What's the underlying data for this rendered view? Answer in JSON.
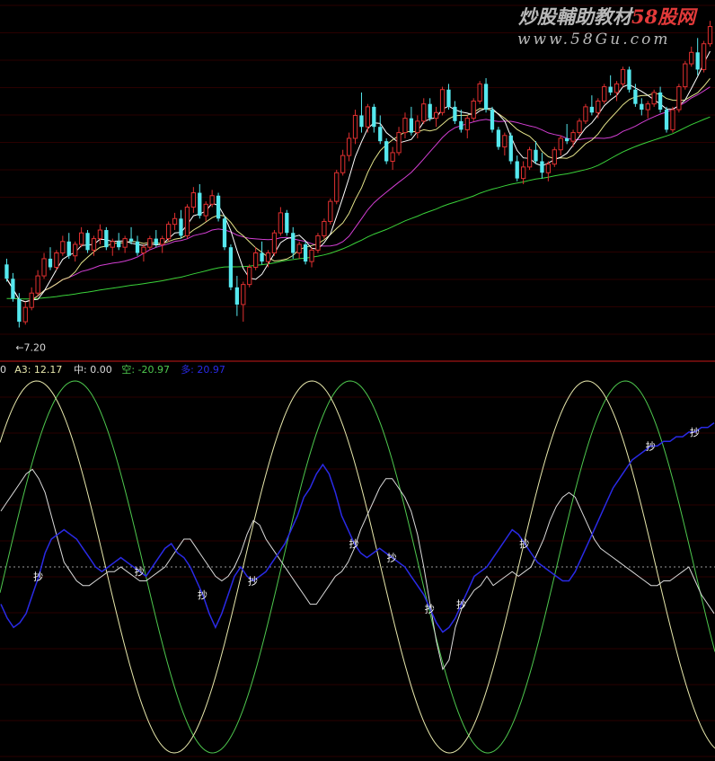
{
  "watermark": {
    "title_a": "炒股輔助教材",
    "title_b": "58股网",
    "url": "www.58Gu.com",
    "color_a": "#b9b9b9",
    "color_b": "#e23a3a"
  },
  "colors": {
    "background": "#000000",
    "grid": "#2a0000",
    "divider": "#c81818",
    "up": "#e03030",
    "down": "#55e8ee",
    "ma5": "#ffffff",
    "ma10": "#e6e68c",
    "ma20": "#d23ed2",
    "ma60": "#3ad23a",
    "sine_a": "#e8e8ac",
    "sine_b": "#4ec84e",
    "osc_white": "#dadada",
    "osc_blue": "#2a2ae6",
    "zero_line": "#9a9a9a",
    "signal_text": "#ffffff"
  },
  "chart_data": [
    {
      "type": "candlestick",
      "name": "price",
      "low_label": "←7.20",
      "low_value": 7.2,
      "ylim": [
        6.8,
        12.6
      ],
      "bars": 114,
      "overlays": [
        "MA5",
        "MA10",
        "MA20",
        "MA60"
      ],
      "ohlc": [
        [
          8.3,
          8.4,
          8.0,
          8.05
        ],
        [
          8.05,
          8.15,
          7.65,
          7.7
        ],
        [
          7.7,
          7.8,
          7.2,
          7.3
        ],
        [
          7.3,
          7.65,
          7.25,
          7.55
        ],
        [
          7.55,
          7.9,
          7.5,
          7.8
        ],
        [
          7.8,
          8.2,
          7.75,
          8.1
        ],
        [
          8.1,
          8.5,
          8.05,
          8.4
        ],
        [
          8.4,
          8.6,
          8.2,
          8.25
        ],
        [
          8.25,
          8.55,
          8.2,
          8.5
        ],
        [
          8.5,
          8.8,
          8.45,
          8.7
        ],
        [
          8.7,
          8.85,
          8.4,
          8.45
        ],
        [
          8.45,
          8.7,
          8.35,
          8.65
        ],
        [
          8.65,
          8.95,
          8.6,
          8.85
        ],
        [
          8.85,
          8.9,
          8.5,
          8.55
        ],
        [
          8.55,
          8.8,
          8.45,
          8.75
        ],
        [
          8.75,
          9.0,
          8.65,
          8.9
        ],
        [
          8.9,
          8.95,
          8.55,
          8.6
        ],
        [
          8.6,
          8.75,
          8.45,
          8.7
        ],
        [
          8.7,
          8.85,
          8.55,
          8.6
        ],
        [
          8.6,
          8.8,
          8.5,
          8.75
        ],
        [
          8.75,
          8.95,
          8.65,
          8.7
        ],
        [
          8.7,
          8.8,
          8.45,
          8.5
        ],
        [
          8.5,
          8.65,
          8.35,
          8.6
        ],
        [
          8.6,
          8.8,
          8.55,
          8.75
        ],
        [
          8.75,
          8.9,
          8.6,
          8.65
        ],
        [
          8.65,
          8.8,
          8.5,
          8.75
        ],
        [
          8.75,
          9.05,
          8.7,
          9.0
        ],
        [
          9.0,
          9.2,
          8.9,
          9.1
        ],
        [
          9.1,
          9.25,
          8.75,
          8.8
        ],
        [
          8.8,
          9.35,
          8.75,
          9.3
        ],
        [
          9.3,
          9.65,
          9.2,
          9.55
        ],
        [
          9.55,
          9.7,
          9.1,
          9.15
        ],
        [
          9.15,
          9.4,
          9.05,
          9.35
        ],
        [
          9.35,
          9.6,
          9.3,
          9.5
        ],
        [
          9.5,
          9.55,
          9.05,
          9.1
        ],
        [
          9.1,
          9.15,
          8.55,
          8.6
        ],
        [
          8.6,
          8.65,
          7.85,
          7.9
        ],
        [
          7.9,
          8.1,
          7.4,
          7.6
        ],
        [
          7.6,
          8.0,
          7.3,
          7.95
        ],
        [
          7.95,
          8.3,
          7.9,
          8.25
        ],
        [
          8.25,
          8.6,
          8.2,
          8.5
        ],
        [
          8.5,
          8.7,
          8.3,
          8.35
        ],
        [
          8.35,
          8.55,
          8.25,
          8.5
        ],
        [
          8.5,
          8.9,
          8.45,
          8.85
        ],
        [
          8.85,
          9.3,
          8.8,
          9.2
        ],
        [
          9.2,
          9.25,
          8.8,
          8.85
        ],
        [
          8.85,
          8.95,
          8.4,
          8.5
        ],
        [
          8.5,
          8.7,
          8.4,
          8.65
        ],
        [
          8.65,
          8.7,
          8.3,
          8.35
        ],
        [
          8.35,
          8.6,
          8.25,
          8.55
        ],
        [
          8.55,
          8.85,
          8.5,
          8.8
        ],
        [
          8.8,
          9.1,
          8.75,
          9.05
        ],
        [
          9.05,
          9.45,
          9.0,
          9.4
        ],
        [
          9.4,
          9.95,
          9.35,
          9.9
        ],
        [
          9.9,
          10.3,
          9.85,
          10.2
        ],
        [
          10.2,
          10.6,
          10.1,
          10.5
        ],
        [
          10.5,
          11.0,
          10.4,
          10.9
        ],
        [
          10.9,
          11.3,
          10.6,
          10.7
        ],
        [
          10.7,
          11.1,
          10.6,
          11.05
        ],
        [
          11.05,
          11.1,
          10.6,
          10.7
        ],
        [
          10.7,
          10.9,
          10.4,
          10.45
        ],
        [
          10.45,
          10.5,
          10.05,
          10.1
        ],
        [
          10.1,
          10.35,
          9.95,
          10.25
        ],
        [
          10.25,
          10.7,
          10.2,
          10.6
        ],
        [
          10.6,
          10.95,
          10.5,
          10.85
        ],
        [
          10.85,
          11.05,
          10.55,
          10.6
        ],
        [
          10.6,
          10.9,
          10.5,
          10.8
        ],
        [
          10.8,
          11.2,
          10.75,
          11.1
        ],
        [
          11.1,
          11.2,
          10.8,
          10.85
        ],
        [
          10.85,
          11.05,
          10.7,
          10.95
        ],
        [
          10.95,
          11.4,
          10.9,
          11.35
        ],
        [
          11.35,
          11.45,
          11.0,
          11.05
        ],
        [
          11.05,
          11.15,
          10.75,
          10.8
        ],
        [
          10.8,
          11.0,
          10.6,
          10.65
        ],
        [
          10.65,
          10.9,
          10.5,
          10.85
        ],
        [
          10.85,
          11.2,
          10.8,
          11.15
        ],
        [
          11.15,
          11.5,
          11.1,
          11.45
        ],
        [
          11.45,
          11.55,
          10.95,
          11.0
        ],
        [
          11.0,
          11.05,
          10.6,
          10.65
        ],
        [
          10.65,
          10.7,
          10.3,
          10.35
        ],
        [
          10.35,
          10.6,
          10.2,
          10.55
        ],
        [
          10.55,
          10.6,
          10.05,
          10.1
        ],
        [
          10.1,
          10.2,
          9.75,
          9.8
        ],
        [
          9.8,
          10.1,
          9.7,
          10.0
        ],
        [
          10.0,
          10.35,
          9.95,
          10.3
        ],
        [
          10.3,
          10.45,
          10.05,
          10.1
        ],
        [
          10.1,
          10.25,
          9.8,
          9.9
        ],
        [
          9.9,
          10.1,
          9.75,
          10.05
        ],
        [
          10.05,
          10.35,
          10.0,
          10.3
        ],
        [
          10.3,
          10.55,
          10.2,
          10.5
        ],
        [
          10.5,
          10.75,
          10.4,
          10.45
        ],
        [
          10.45,
          10.65,
          10.35,
          10.6
        ],
        [
          10.6,
          10.85,
          10.55,
          10.8
        ],
        [
          10.8,
          11.1,
          10.75,
          11.05
        ],
        [
          11.05,
          11.25,
          10.9,
          10.95
        ],
        [
          10.95,
          11.2,
          10.85,
          11.15
        ],
        [
          11.15,
          11.45,
          11.1,
          11.4
        ],
        [
          11.4,
          11.6,
          11.25,
          11.3
        ],
        [
          11.3,
          11.5,
          11.15,
          11.45
        ],
        [
          11.45,
          11.75,
          11.4,
          11.7
        ],
        [
          11.7,
          11.75,
          11.3,
          11.35
        ],
        [
          11.35,
          11.45,
          11.05,
          11.1
        ],
        [
          11.1,
          11.2,
          10.9,
          11.0
        ],
        [
          11.0,
          11.15,
          10.85,
          11.1
        ],
        [
          11.1,
          11.35,
          11.05,
          11.3
        ],
        [
          11.3,
          11.4,
          10.95,
          11.0
        ],
        [
          11.0,
          11.05,
          10.6,
          10.65
        ],
        [
          10.65,
          11.05,
          10.6,
          11.0
        ],
        [
          11.0,
          11.45,
          10.95,
          11.4
        ],
        [
          11.4,
          11.85,
          11.35,
          11.8
        ],
        [
          11.8,
          12.1,
          11.75,
          12.0
        ],
        [
          12.0,
          12.25,
          11.6,
          11.7
        ],
        [
          11.7,
          12.2,
          11.65,
          12.15
        ],
        [
          12.15,
          12.55,
          12.1,
          12.45
        ]
      ]
    },
    {
      "type": "line",
      "name": "oscillator",
      "legend": [
        {
          "label": "0",
          "color": "#dadada"
        },
        {
          "label": "A3: 12.17",
          "color": "#e8e8ac"
        },
        {
          "label": "中: 0.00",
          "color": "#dadada"
        },
        {
          "label": "空: -20.97",
          "color": "#4ec84e"
        },
        {
          "label": "多: 20.97",
          "color": "#2a2ae6"
        }
      ],
      "ylim": [
        -40,
        40
      ],
      "zero_line": 0,
      "sine_a": {
        "amplitude": 40,
        "period_bars": 43.5,
        "phase_deg": 42
      },
      "sine_b": {
        "amplitude": 40,
        "period_bars": 43.5,
        "phase_deg": -8
      },
      "white_line": [
        12,
        14,
        16,
        18,
        20,
        21,
        19,
        16,
        11,
        6,
        1,
        -1,
        -3,
        -4,
        -4,
        -3,
        -2,
        -1,
        -1,
        0,
        -1,
        -2,
        -3,
        -3,
        -2,
        -1,
        0,
        2,
        4,
        6,
        6,
        4,
        2,
        0,
        -2,
        -3,
        -2,
        0,
        3,
        7,
        10,
        9,
        6,
        4,
        2,
        0,
        -2,
        -4,
        -6,
        -8,
        -8,
        -6,
        -4,
        -2,
        -1,
        1,
        4,
        8,
        11,
        14,
        17,
        19,
        19,
        17,
        15,
        12,
        7,
        0,
        -8,
        -16,
        -22,
        -20,
        -13,
        -9,
        -7,
        -5,
        -4,
        -2,
        -4,
        -3,
        -2,
        -1,
        -2,
        -1,
        0,
        3,
        6,
        10,
        13,
        15,
        16,
        15,
        12,
        9,
        6,
        4,
        3,
        2,
        1,
        0,
        -1,
        -2,
        -3,
        -4,
        -4,
        -3,
        -3,
        -2,
        -1,
        0,
        -3,
        -6,
        -8,
        -10
      ],
      "blue_line": [
        -8,
        -11,
        -13,
        -12,
        -10,
        -6,
        -2,
        3,
        6,
        7,
        8,
        7,
        6,
        4,
        2,
        0,
        -1,
        0,
        1,
        2,
        1,
        0,
        -1,
        -2,
        0,
        2,
        4,
        5,
        3,
        2,
        0,
        -3,
        -6,
        -10,
        -13,
        -10,
        -6,
        -2,
        0,
        -2,
        -3,
        -2,
        -1,
        1,
        3,
        5,
        8,
        11,
        15,
        17,
        20,
        22,
        20,
        16,
        11,
        8,
        5,
        3,
        2,
        3,
        4,
        3,
        2,
        1,
        0,
        -2,
        -4,
        -6,
        -9,
        -12,
        -14,
        -13,
        -11,
        -8,
        -5,
        -2,
        -1,
        0,
        2,
        4,
        6,
        8,
        7,
        5,
        3,
        1,
        0,
        -1,
        -2,
        -3,
        -3,
        -1,
        2,
        5,
        8,
        11,
        14,
        17,
        19,
        21,
        23,
        24,
        25,
        26,
        26,
        27,
        27,
        28,
        28,
        29,
        29,
        30,
        30,
        31
      ],
      "signals": [
        {
          "bar": 7,
          "label": "抄"
        },
        {
          "bar": 26,
          "label": "抄"
        },
        {
          "bar": 38,
          "label": "抄"
        },
        {
          "bar": 48,
          "label": "抄"
        },
        {
          "bar": 66,
          "label": "抄"
        },
        {
          "bar": 74,
          "label": "抄"
        },
        {
          "bar": 81,
          "label": "抄"
        },
        {
          "bar": 86,
          "label": "抄"
        },
        {
          "bar": 98,
          "label": "抄"
        },
        {
          "bar": 122,
          "label": "抄"
        },
        {
          "bar": 131,
          "label": "抄"
        }
      ]
    }
  ]
}
